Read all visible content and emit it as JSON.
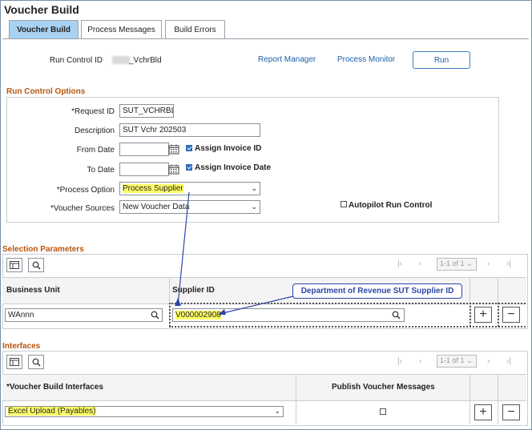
{
  "page": {
    "title": "Voucher Build"
  },
  "tabs": [
    {
      "label": "Voucher Build",
      "active": true
    },
    {
      "label": "Process Messages",
      "active": false
    },
    {
      "label": "Build Errors",
      "active": false
    }
  ],
  "header": {
    "run_control_label": "Run Control ID",
    "run_control_value": "_VchrBld",
    "report_manager": "Report Manager",
    "process_monitor": "Process Monitor",
    "run_button": "Run"
  },
  "run_control_options": {
    "title": "Run Control Options",
    "request_id_label": "*Request ID",
    "request_id_value": "SUT_VCHRBL",
    "description_label": "Description",
    "description_value": "SUT Vchr 202503",
    "from_date_label": "From Date",
    "to_date_label": "To Date",
    "assign_invoice_id": "Assign Invoice ID",
    "assign_invoice_date": "Assign Invoice Date",
    "process_option_label": "*Process Option",
    "process_option_value": "Process Supplier",
    "voucher_sources_label": "*Voucher Sources",
    "voucher_sources_value": "New Voucher Data",
    "autopilot_label": "Autopilot Run Control",
    "assign_invoice_id_checked": true,
    "assign_invoice_date_checked": true,
    "autopilot_checked": false
  },
  "selection_parameters": {
    "title": "Selection Parameters",
    "pager_text": "1-1 of 1",
    "col_business_unit": "Business Unit",
    "col_supplier_id": "Supplier ID",
    "business_unit_value": "WAnnn",
    "supplier_id_value": "V000002908",
    "callout": "Department of Revenue SUT Supplier ID"
  },
  "interfaces": {
    "title": "Interfaces",
    "pager_text": "1-1 of 1",
    "col_interfaces": "*Voucher Build Interfaces",
    "col_publish": "Publish Voucher Messages",
    "interface_value": "Excel Upload (Payables)",
    "publish_checked": false
  },
  "colors": {
    "accent_link": "#1d5ea8",
    "section_title": "#b8540c",
    "highlight": "#ffff66",
    "annotation": "#2e45a8",
    "active_tab": "#a9d2f2"
  }
}
